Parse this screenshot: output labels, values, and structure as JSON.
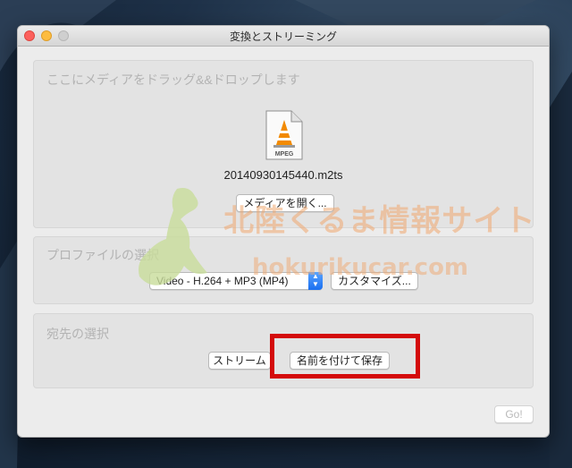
{
  "window": {
    "title": "変換とストリーミング"
  },
  "drop_area": {
    "title": "ここにメディアをドラッグ&&ドロップします",
    "file_icon_label": "MPEG",
    "file_name": "20140930145440.m2ts",
    "open_media_button": "メディアを開く..."
  },
  "profile": {
    "title": "プロファイルの選択",
    "selected": "Video - H.264 + MP3 (MP4)",
    "customize_button": "カスタマイズ..."
  },
  "destination": {
    "title": "宛先の選択",
    "stream_button": "ストリーム",
    "save_as_button": "名前を付けて保存"
  },
  "go_button": "Go!",
  "watermark": {
    "text": "北陸くるま情報サイト",
    "url": "hokurikucar.com"
  },
  "colors": {
    "highlight": "#d40b0b",
    "watermark_orange": "#f0a870",
    "watermark_green": "#c8dc9a"
  }
}
